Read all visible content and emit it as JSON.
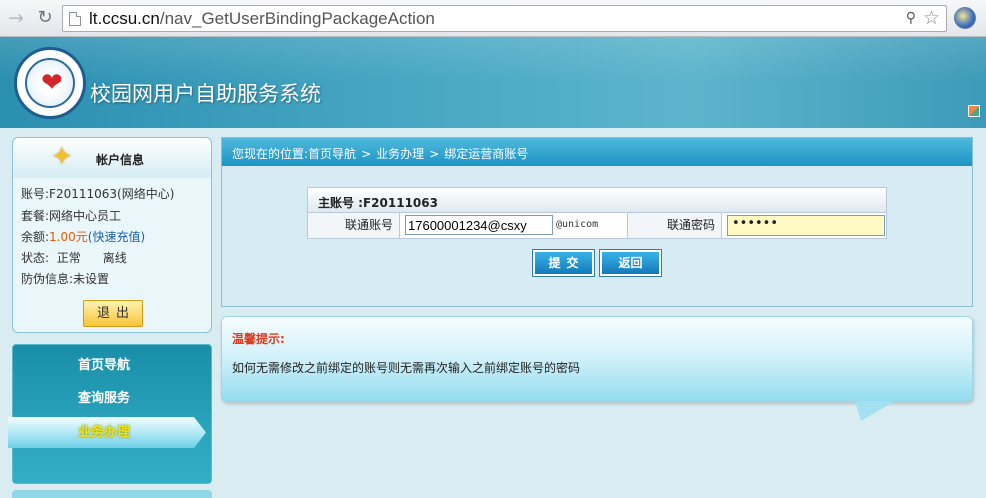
{
  "browser": {
    "url_host": "lt.ccsu.cn",
    "url_path": "/nav_GetUserBindingPackageAction"
  },
  "header": {
    "title": "校园网用户自助服务系统"
  },
  "account": {
    "title": "帐户信息",
    "account_label": "账号:",
    "account_value": "F20111063(网络中心)",
    "package_label": "套餐:",
    "package_value": "网络中心员工",
    "balance_label": "余额:",
    "balance_value": "1.00元",
    "recharge_link": "(快速充值)",
    "status_label": "状态:",
    "status_value": "正常",
    "offline_link": "离线",
    "security_label": "防伪信息:",
    "security_value": "未设置",
    "logout_label": "退出"
  },
  "menu": {
    "items": [
      {
        "label": "首页导航"
      },
      {
        "label": "查询服务"
      },
      {
        "label": "业务办理"
      }
    ]
  },
  "breadcrumb": {
    "prefix": "您现在的位置:",
    "items": [
      "首页导航",
      "业务办理",
      "绑定运营商账号"
    ],
    "separator": ">"
  },
  "form": {
    "header": "主账号 :F20111063",
    "account_label": "联通账号",
    "account_value": "17600001234@csxy",
    "account_suffix": "@unicom",
    "password_label": "联通密码",
    "password_value": "••••••",
    "submit_label": "提交",
    "back_label": "返回"
  },
  "tip": {
    "title": "温馨提示:",
    "text": "如何无需修改之前绑定的账号则无需再次输入之前绑定账号的密码"
  },
  "colors": {
    "accent": "#1d94c5",
    "balance": "#e25b00",
    "tip_title": "#e03a1e",
    "active_menu_text": "#f2e21c"
  }
}
